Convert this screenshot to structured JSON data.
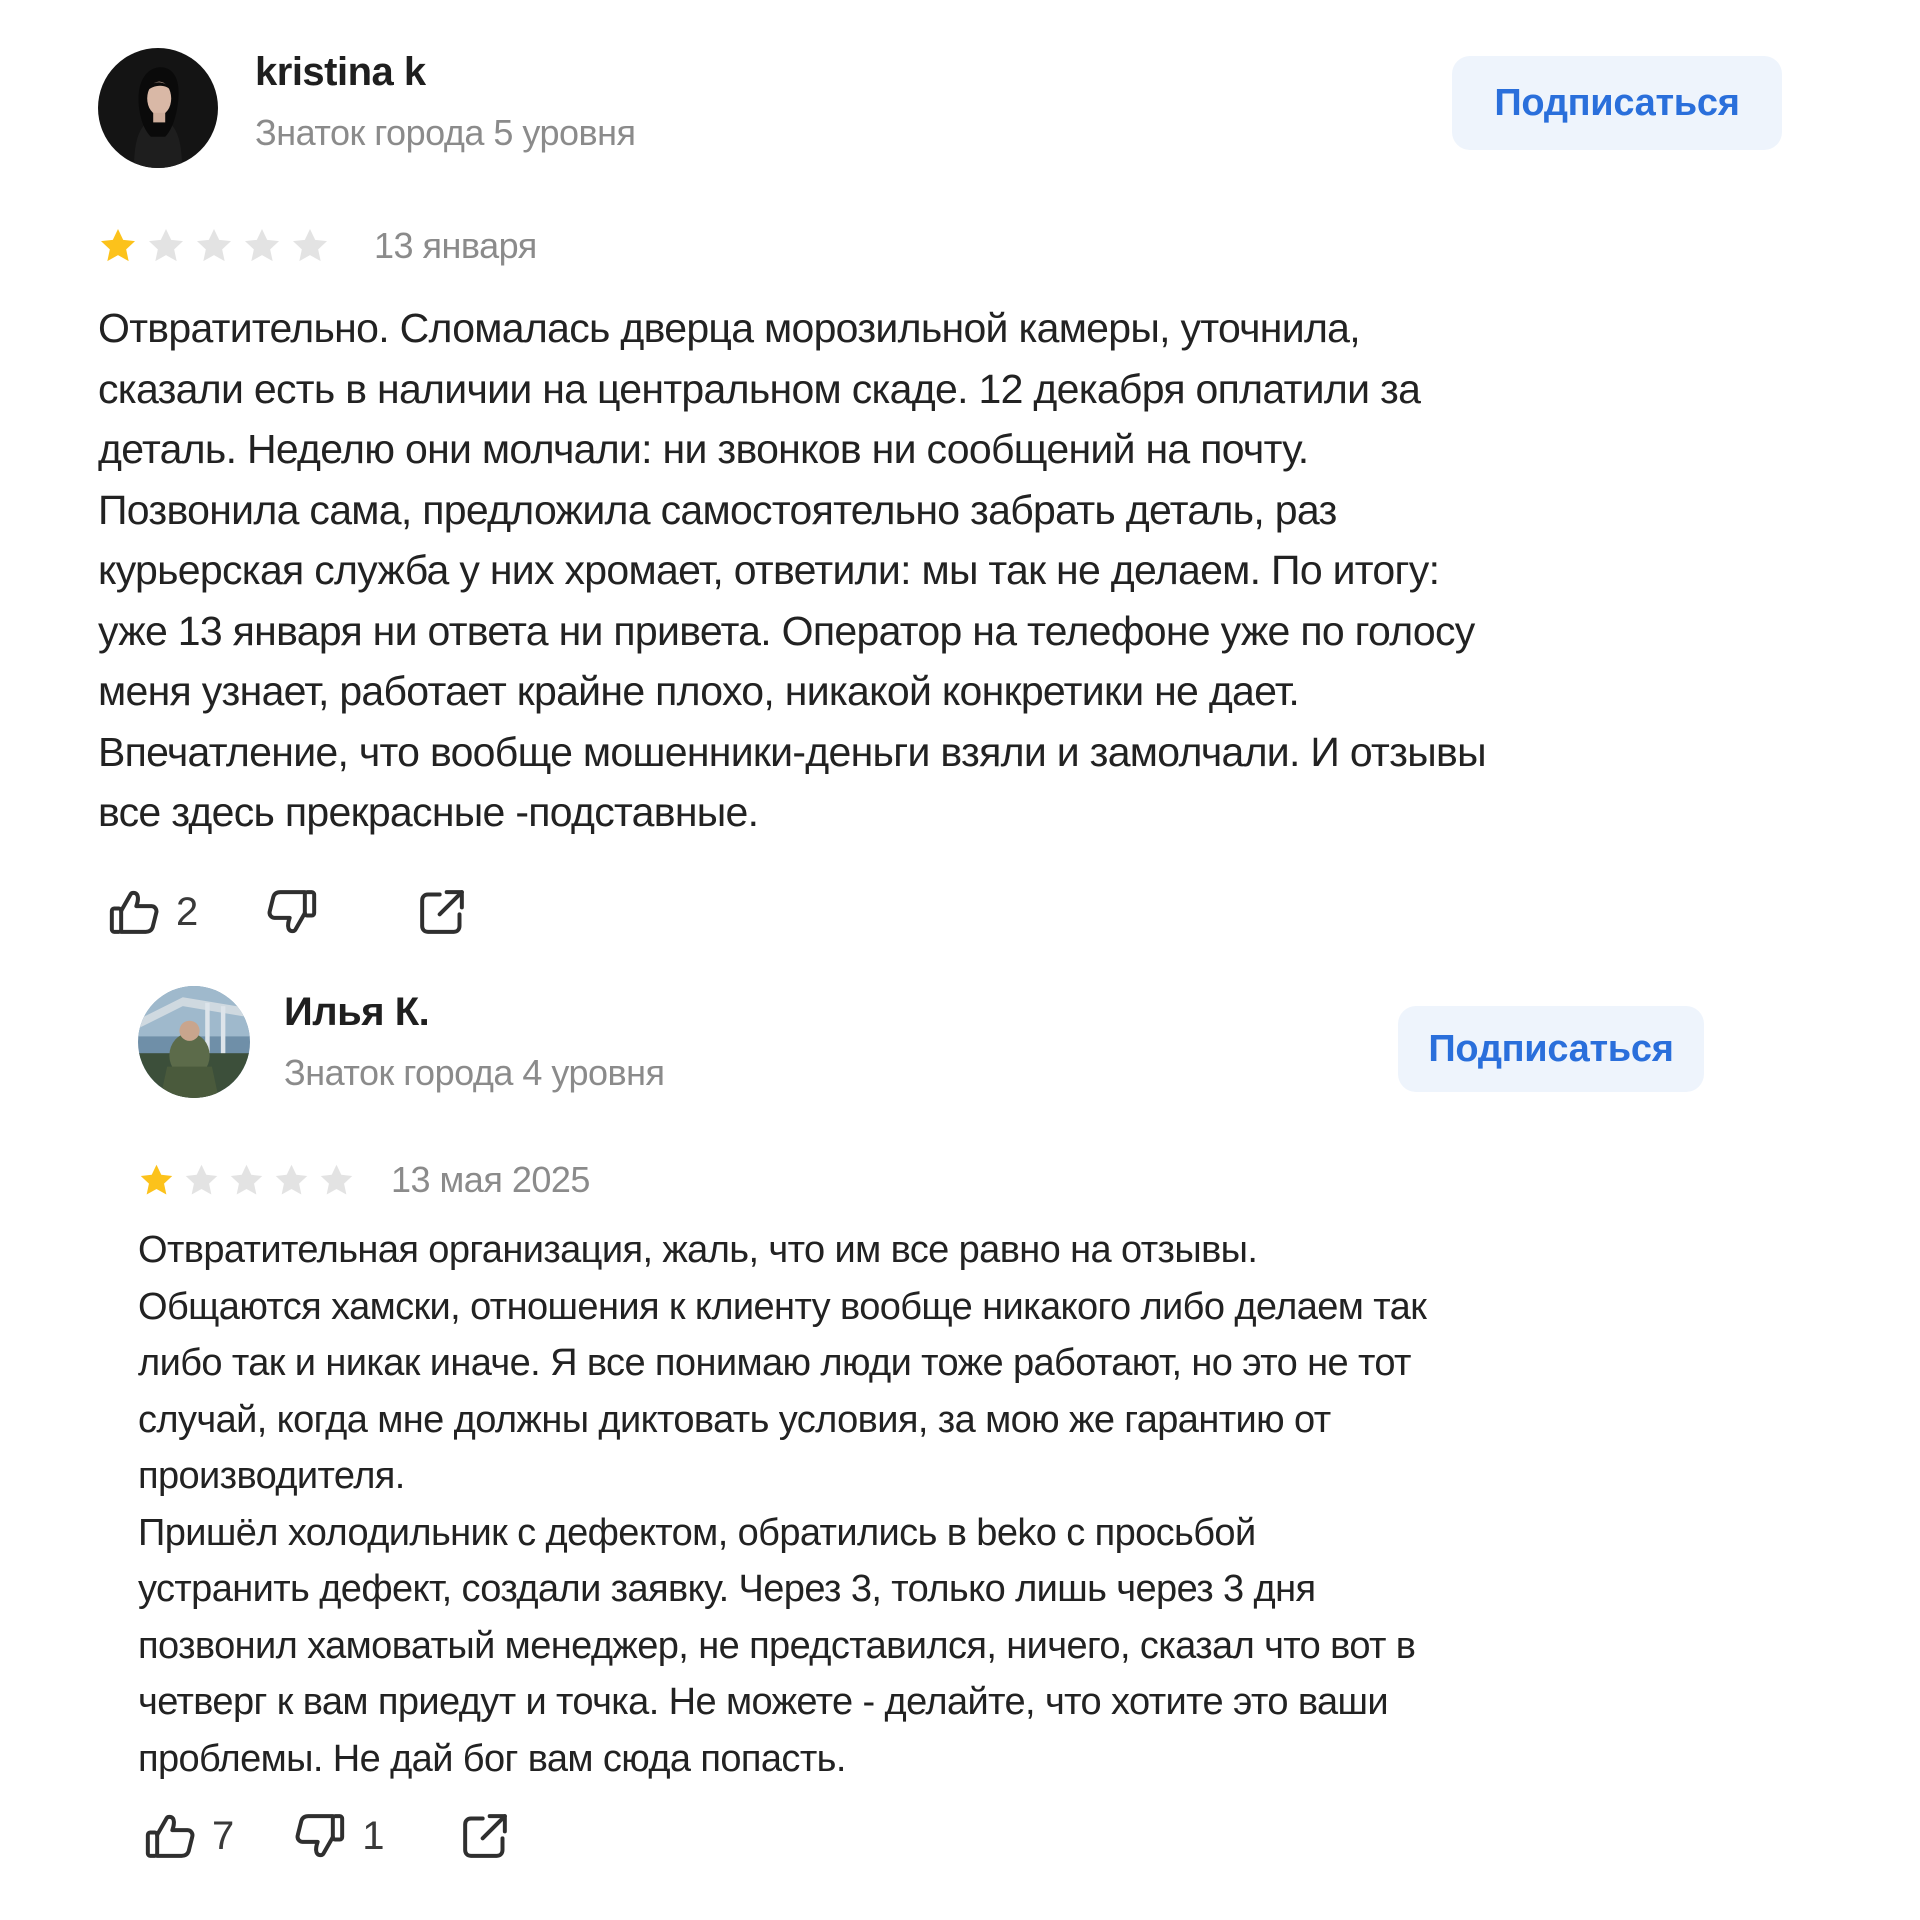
{
  "reviews": [
    {
      "author": {
        "name": "kristina k",
        "level": "Знаток города 5 уровня",
        "avatar": "avatar-photo-woman"
      },
      "subscribe_label": "Подписаться",
      "rating": 1,
      "max_rating": 5,
      "date": "13 января",
      "text_lines": [
        "Отвратительно. Сломалась дверца морозильной камеры, уточнила,",
        "сказали есть в наличии на центральном скаде. 12 декабря оплатили за",
        "деталь. Неделю они молчали: ни звонков ни сообщений на почту.",
        "Позвонила сама, предложила самостоятельно забрать деталь, раз",
        "курьерская служба у них хромает, ответили: мы так не делаем. По итогу:",
        "уже 13 января ни ответа ни привета. Оператор на телефоне уже по голосу",
        "меня узнает, работает крайне плохо, никакой конкретики не дает.",
        "Впечатление, что вообще мошенники-деньги взяли и замолчали. И отзывы",
        "все здесь прекрасные -подставные."
      ],
      "likes": "2",
      "dislikes": "",
      "icons": {
        "like": "thumbs-up-icon",
        "dislike": "thumbs-down-icon",
        "share": "share-icon"
      }
    },
    {
      "author": {
        "name": "Илья К.",
        "level": "Знаток города 4 уровня",
        "avatar": "avatar-photo-man"
      },
      "subscribe_label": "Подписаться",
      "rating": 1,
      "max_rating": 5,
      "date": "13 мая 2025",
      "text_lines": [
        "Отвратительная организация, жаль, что им все равно на отзывы.",
        "Общаются хамски, отношения к клиенту вообще никакого либо делаем так",
        "либо так и никак иначе. Я все понимаю люди тоже работают, но это не тот",
        "случай, когда мне должны диктовать условия, за мою же гарантию от",
        "производителя.",
        "Пришёл холодильник с дефектом, обратились в beko с просьбой",
        "устранить дефект, создали заявку. Через 3, только лишь через 3 дня",
        "позвонил хамоватый менеджер, не представился, ничего, сказал что вот в",
        "четверг к вам приедут и точка. Не можете - делайте, что хотите это ваши",
        "проблемы. Не дай бог вам сюда попасть."
      ],
      "likes": "7",
      "dislikes": "1",
      "icons": {
        "like": "thumbs-up-icon",
        "dislike": "thumbs-down-icon",
        "share": "share-icon"
      }
    }
  ],
  "colors": {
    "star_filled": "#fcc21b",
    "star_empty": "#e3e3e3",
    "subscribe_bg": "#eef4fc",
    "subscribe_text": "#2a6fdb",
    "muted_text": "#8b8b8b"
  }
}
